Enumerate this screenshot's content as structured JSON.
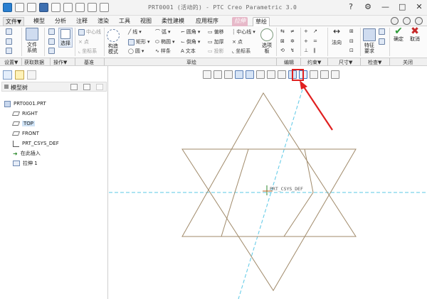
{
  "window": {
    "title": "PRT0001 (活动的) - PTC Creo Parametric 3.0",
    "controls": [
      "?",
      "⚙",
      "—",
      "□",
      "✕"
    ]
  },
  "tabs": [
    {
      "label": "文件▼",
      "kind": "file"
    },
    {
      "label": "模型"
    },
    {
      "label": "分析"
    },
    {
      "label": "注释"
    },
    {
      "label": "渲染"
    },
    {
      "label": "工具"
    },
    {
      "label": "视图"
    },
    {
      "label": "柔性建模"
    },
    {
      "label": "应用程序"
    },
    {
      "label": "拉伸",
      "kind": "special"
    },
    {
      "label": "草绘",
      "kind": "active"
    }
  ],
  "ribbon": {
    "file_system": "文件\n系统",
    "select": "选择",
    "centerline_left": "中心线",
    "point_left": "点",
    "coord_left": "坐标系",
    "construction_mode": "构造\n模式",
    "line": "线",
    "rectangle": "矩形",
    "circle": "圆",
    "arc": "弧",
    "ellipse": "椭圆",
    "spline": "样条",
    "fillet": "圆角",
    "chamfer": "倒角",
    "text": "文本",
    "offset": "偏移",
    "thicken": "加厚",
    "project": "投影",
    "centerline": "中心线",
    "point": "点",
    "coordsys": "坐标系",
    "palette": "选项\n板",
    "normal": "法向",
    "feature_req": "特征\n要求",
    "ok": "确定",
    "cancel": "取消"
  },
  "groups": {
    "settings": "设置▼",
    "get_data": "获取数据",
    "operations": "操作▼",
    "datum": "基准",
    "sketch": "草绘",
    "edit": "编辑",
    "constrain": "约束▼",
    "dimension": "尺寸▼",
    "inspect": "检查▼",
    "close": "关闭"
  },
  "panel": {
    "title": "模型树",
    "items": [
      {
        "label": "PRT0001.PRT",
        "icon": "part-icon"
      },
      {
        "label": "RIGHT",
        "icon": "datum-plane-icon"
      },
      {
        "label": "TOP",
        "icon": "datum-plane-icon",
        "selected": true
      },
      {
        "label": "FRONT",
        "icon": "datum-plane-icon"
      },
      {
        "label": "PRT_CSYS_DEF",
        "icon": "csys-icon"
      },
      {
        "label": "在此插入",
        "icon": "insert-arrow-icon"
      },
      {
        "label": "拉伸 1",
        "icon": "extrude-icon"
      }
    ]
  },
  "graphics": {
    "csys_label": "PRT_CSYS_DEF",
    "sketch_color": "#a08a6a",
    "axis_color": "#5bc8e6",
    "callout_color": "#e02020"
  }
}
